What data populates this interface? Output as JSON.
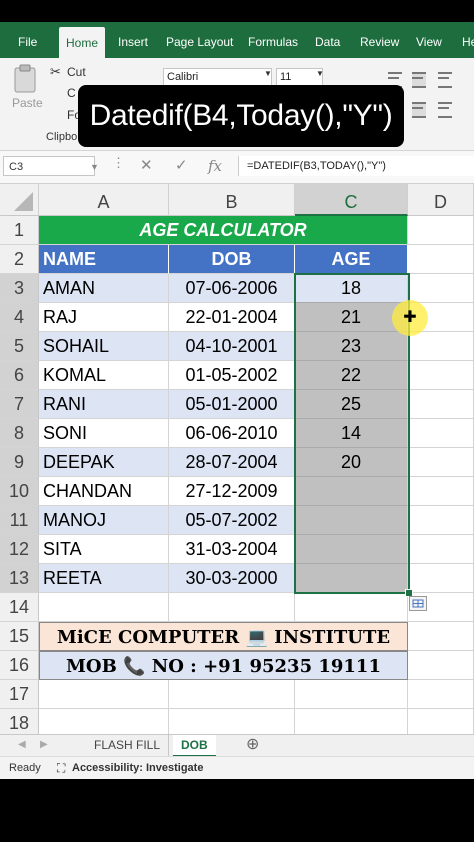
{
  "ribbon": {
    "tabs": [
      "File",
      "Home",
      "Insert",
      "Page Layout",
      "Formulas",
      "Data",
      "Review",
      "View",
      "He"
    ],
    "active_tab": "Home",
    "paste_label": "Paste",
    "cut_label": "Cut",
    "copy_label": "C",
    "format_label": "Fo",
    "clipboard_label": "Clipbo",
    "font_name": "Calibri",
    "font_size": "11"
  },
  "overlay_text": "Datedif(B4,Today(),\"Y\")",
  "formula_bar": {
    "name_box": "C3",
    "cancel_icon": "✕",
    "enter_icon": "✓",
    "fx_label": "fx",
    "formula": "=DATEDIF(B3,TODAY(),\"Y\")"
  },
  "columns": [
    "A",
    "B",
    "C",
    "D"
  ],
  "rows": [
    "1",
    "2",
    "3",
    "4",
    "5",
    "6",
    "7",
    "8",
    "9",
    "10",
    "11",
    "12",
    "13",
    "14",
    "15",
    "16",
    "17",
    "18"
  ],
  "sheet": {
    "title": "AGE CALCULATOR",
    "headers": [
      "NAME",
      "DOB",
      "AGE"
    ],
    "records": [
      {
        "name": "AMAN",
        "dob": "07-06-2006",
        "age": "18"
      },
      {
        "name": "RAJ",
        "dob": "22-01-2004",
        "age": "21"
      },
      {
        "name": "SOHAIL",
        "dob": "04-10-2001",
        "age": "23"
      },
      {
        "name": "KOMAL",
        "dob": "01-05-2002",
        "age": "22"
      },
      {
        "name": "RANI",
        "dob": "05-01-2000",
        "age": "25"
      },
      {
        "name": "SONI",
        "dob": "06-06-2010",
        "age": "14"
      },
      {
        "name": "DEEPAK",
        "dob": "28-07-2004",
        "age": "20"
      },
      {
        "name": "CHANDAN",
        "dob": "27-12-2009",
        "age": ""
      },
      {
        "name": "MANOJ",
        "dob": "05-07-2002",
        "age": ""
      },
      {
        "name": "SITA",
        "dob": "31-03-2004",
        "age": ""
      },
      {
        "name": "REETA",
        "dob": "30-03-2000",
        "age": ""
      }
    ],
    "footer_line1": "MiCE COMPUTER 💻 INSTITUTE",
    "footer_line2": "MOB 📞 NO : +91 95235 19111"
  },
  "sheet_tabs": [
    "FLASH FILL",
    "DOB"
  ],
  "active_sheet": "DOB",
  "add_sheet_icon": "⊕",
  "status": {
    "ready": "Ready",
    "accessibility": "Accessibility: Investigate"
  },
  "colors": {
    "excel_green": "#1e6d3e",
    "title_green": "#19a84a",
    "header_blue": "#4472c4",
    "band_blue": "#dde4f4",
    "footer_peach": "#fbe5d6",
    "age_gray": "#c0c0c0"
  }
}
